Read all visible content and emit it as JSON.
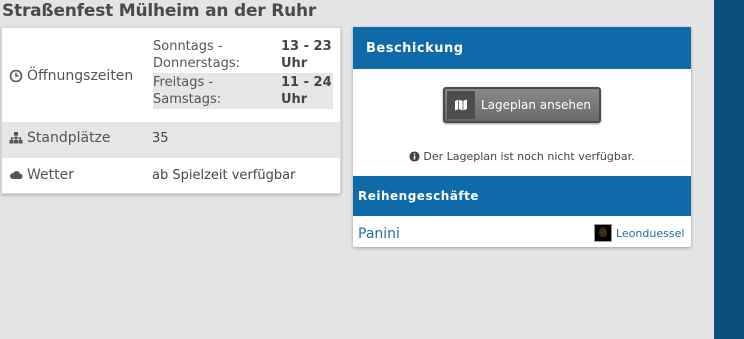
{
  "page": {
    "title": "Straßenfest Mülheim an der Ruhr"
  },
  "info": {
    "hours": {
      "label": "Öffnungszeiten",
      "icon": "clock-icon",
      "rows": [
        {
          "days_line1": "Sonntags -",
          "days_line2": "Donnerstags:",
          "time_line1": "13 - 23",
          "time_line2": "Uhr"
        },
        {
          "days_line1": "Freitags -",
          "days_line2": "Samstags:",
          "time_line1": "11 - 24",
          "time_line2": "Uhr"
        }
      ]
    },
    "stands": {
      "label": "Standplätze",
      "icon": "sitemap-icon",
      "value": "35"
    },
    "weather": {
      "label": "Wetter",
      "icon": "cloud-icon",
      "value": "ab Spielzeit verfügbar"
    }
  },
  "side": {
    "loading_title": "Beschickung",
    "map_button_label": "Lageplan ansehen",
    "map_icon": "map-icon",
    "notice": "Der Lageplan ist noch nicht verfügbar.",
    "rides_title": "Reihengeschäfte",
    "rides": [
      {
        "name": "Panini",
        "user": "Leonduessel"
      }
    ]
  },
  "colors": {
    "header_blue": "#0e6aa8",
    "strip_blue": "#0b4f7c",
    "link_blue": "#1a6fa8"
  }
}
